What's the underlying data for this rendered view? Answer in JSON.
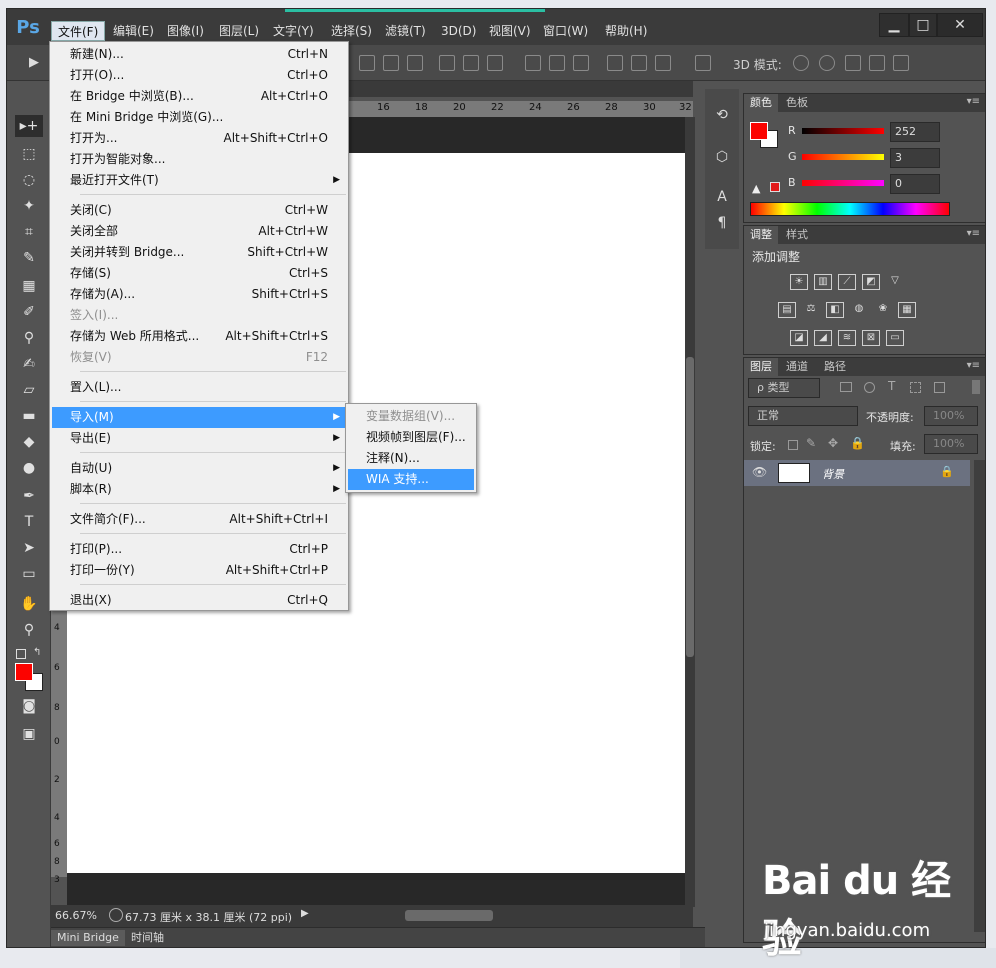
{
  "app": {
    "logo": "Ps",
    "menubar": [
      "文件(F)",
      "编辑(E)",
      "图像(I)",
      "图层(L)",
      "文字(Y)",
      "选择(S)",
      "滤镜(T)",
      "3D(D)",
      "视图(V)",
      "窗口(W)",
      "帮助(H)"
    ],
    "window_buttons": [
      "▁",
      "□",
      "✕"
    ]
  },
  "options_bar": {
    "mode_label": "3D 模式:"
  },
  "ruler": {
    "top_ticks": [
      "16",
      "18",
      "20",
      "22",
      "24",
      "26",
      "28",
      "30",
      "32"
    ],
    "left_ticks": [
      "4",
      "6",
      "8",
      "0",
      "2",
      "4",
      "6",
      "8",
      "3"
    ]
  },
  "file_menu": {
    "items": [
      {
        "label": "新建(N)...",
        "shortcut": "Ctrl+N"
      },
      {
        "label": "打开(O)...",
        "shortcut": "Ctrl+O"
      },
      {
        "label": "在 Bridge 中浏览(B)...",
        "shortcut": "Alt+Ctrl+O"
      },
      {
        "label": "在 Mini Bridge 中浏览(G)...",
        "shortcut": ""
      },
      {
        "label": "打开为...",
        "shortcut": "Alt+Shift+Ctrl+O"
      },
      {
        "label": "打开为智能对象...",
        "shortcut": ""
      },
      {
        "label": "最近打开文件(T)",
        "shortcut": ""
      },
      {
        "label": "关闭(C)",
        "shortcut": "Ctrl+W"
      },
      {
        "label": "关闭全部",
        "shortcut": "Alt+Ctrl+W"
      },
      {
        "label": "关闭并转到 Bridge...",
        "shortcut": "Shift+Ctrl+W"
      },
      {
        "label": "存储(S)",
        "shortcut": "Ctrl+S"
      },
      {
        "label": "存储为(A)...",
        "shortcut": "Shift+Ctrl+S"
      },
      {
        "label": "签入(I)...",
        "shortcut": ""
      },
      {
        "label": "存储为 Web 所用格式...",
        "shortcut": "Alt+Shift+Ctrl+S"
      },
      {
        "label": "恢复(V)",
        "shortcut": "F12"
      },
      {
        "label": "置入(L)...",
        "shortcut": ""
      },
      {
        "label": "导入(M)",
        "shortcut": ""
      },
      {
        "label": "导出(E)",
        "shortcut": ""
      },
      {
        "label": "自动(U)",
        "shortcut": ""
      },
      {
        "label": "脚本(R)",
        "shortcut": ""
      },
      {
        "label": "文件简介(F)...",
        "shortcut": "Alt+Shift+Ctrl+I"
      },
      {
        "label": "打印(P)...",
        "shortcut": "Ctrl+P"
      },
      {
        "label": "打印一份(Y)",
        "shortcut": "Alt+Shift+Ctrl+P"
      },
      {
        "label": "退出(X)",
        "shortcut": "Ctrl+Q"
      }
    ]
  },
  "import_submenu": {
    "items": [
      "变量数据组(V)...",
      "视频帧到图层(F)...",
      "注释(N)...",
      "WIA 支持..."
    ]
  },
  "status": {
    "zoom": "66.67%",
    "doc_size": "67.73 厘米 x 38.1 厘米 (72 ppi)"
  },
  "bottom_tabs": [
    "Mini Bridge",
    "时间轴"
  ],
  "color_panel": {
    "tabs": [
      "颜色",
      "色板"
    ],
    "channels": [
      {
        "label": "R",
        "value": "252"
      },
      {
        "label": "G",
        "value": "3"
      },
      {
        "label": "B",
        "value": "0"
      }
    ],
    "foreground": "#fc0300"
  },
  "adjust_panel": {
    "tabs": [
      "调整",
      "样式"
    ],
    "title": "添加调整"
  },
  "layers_panel": {
    "tabs": [
      "图层",
      "通道",
      "路径"
    ],
    "filter_label": "ρ 类型",
    "blend_mode": "正常",
    "opacity_label": "不透明度:",
    "opacity_value": "100%",
    "lock_label": "锁定:",
    "fill_label": "填充:",
    "fill_value": "100%",
    "layer_name": "背景"
  },
  "watermark": {
    "brand": "Bai du 经验",
    "url": "jingyan.baidu.com"
  }
}
